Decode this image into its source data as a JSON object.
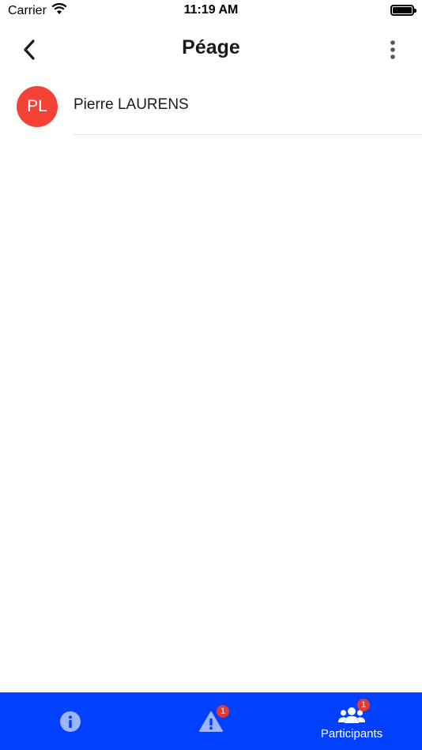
{
  "status_bar": {
    "carrier": "Carrier",
    "time": "11:19 AM"
  },
  "header": {
    "title": "Péage",
    "back_icon": "chevron-left-icon",
    "menu_icon": "more-vertical-icon"
  },
  "participants": [
    {
      "initials": "PL",
      "name": "Pierre LAURENS",
      "avatar_color": "#f44336"
    }
  ],
  "tab_bar": {
    "background": "#0040ff",
    "tabs": [
      {
        "id": "info",
        "icon": "info-icon",
        "label": "",
        "badge": ""
      },
      {
        "id": "alerts",
        "icon": "warning-icon",
        "label": "",
        "badge": "1"
      },
      {
        "id": "participants",
        "icon": "group-icon",
        "label": "Participants",
        "badge": "1",
        "active": true
      }
    ]
  }
}
